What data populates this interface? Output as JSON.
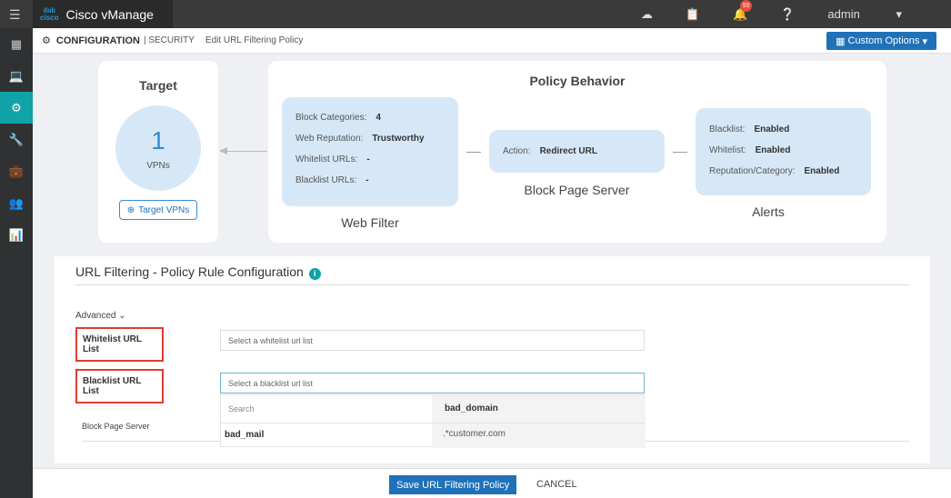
{
  "app": {
    "title": "Cisco vManage",
    "logo_text": "cisco",
    "user": "admin",
    "notification_count": "55"
  },
  "header": {
    "section": "CONFIGURATION",
    "subsection": "SECURITY",
    "page": "Edit URL Filtering Policy",
    "custom_options": "Custom Options"
  },
  "target": {
    "title": "Target",
    "count": "1",
    "unit": "VPNs",
    "button": "Target VPNs"
  },
  "policy": {
    "title": "Policy Behavior",
    "web_filter": {
      "caption": "Web Filter",
      "rows": [
        {
          "k": "Block Categories:",
          "v": "4"
        },
        {
          "k": "Web Reputation:",
          "v": "Trustworthy"
        },
        {
          "k": "Whitelist URLs:",
          "v": "-"
        },
        {
          "k": "Blacklist URLs:",
          "v": "-"
        }
      ]
    },
    "block_page": {
      "caption": "Block Page Server",
      "k": "Action:",
      "v": "Redirect URL"
    },
    "alerts": {
      "caption": "Alerts",
      "rows": [
        {
          "k": "Blacklist:",
          "v": "Enabled"
        },
        {
          "k": "Whitelist:",
          "v": "Enabled"
        },
        {
          "k": "Reputation/Category:",
          "v": "Enabled"
        }
      ]
    }
  },
  "rules": {
    "title": "URL Filtering - Policy Rule Configuration",
    "advanced": "Advanced",
    "whitelist_label": "Whitelist URL List",
    "whitelist_placeholder": "Select a whitelist url list",
    "blacklist_label": "Blacklist URL List",
    "blacklist_placeholder": "Select a blacklist url list",
    "search_placeholder": "Search",
    "options": [
      "bad_mail"
    ],
    "preview_title": "bad_domain",
    "preview_items": [
      ".*customer.com"
    ],
    "block_page_server": "Block Page Server"
  },
  "footer": {
    "save": "Save URL Filtering Policy",
    "cancel": "CANCEL"
  }
}
